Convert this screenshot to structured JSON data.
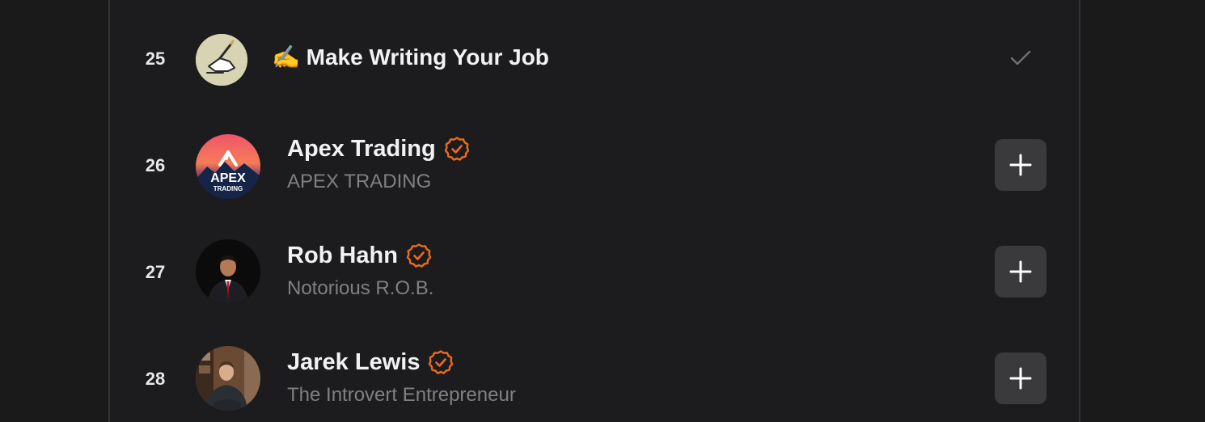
{
  "colors": {
    "background": "#1a1a1b",
    "panel": "#1c1c1e",
    "accent": "#ef6b1c",
    "button": "#3a3a3c",
    "muted_text": "#808080"
  },
  "rows": [
    {
      "rank": "25",
      "title": "✍️ Make Writing Your Job",
      "status_icon": "check-icon"
    },
    {
      "rank": "26",
      "name": "Apex Trading",
      "subtitle": "APEX TRADING",
      "avatar_text_main": "APEX",
      "avatar_text_sub": "TRADING",
      "verified_icon": "verified-badge-icon",
      "action_icon": "plus-icon"
    },
    {
      "rank": "27",
      "name": "Rob Hahn",
      "subtitle": "Notorious R.O.B.",
      "verified_icon": "verified-badge-icon",
      "action_icon": "plus-icon"
    },
    {
      "rank": "28",
      "name": "Jarek Lewis",
      "subtitle": "The Introvert Entrepreneur",
      "verified_icon": "verified-badge-icon",
      "action_icon": "plus-icon"
    }
  ]
}
